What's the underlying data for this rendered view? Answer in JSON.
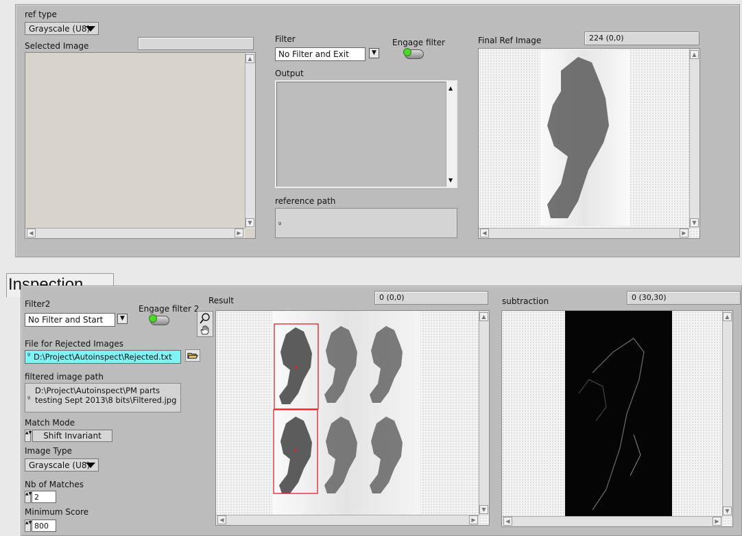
{
  "ref": {
    "ref_type_label": "ref type",
    "ref_type_value": "Grayscale (U8)",
    "selected_image_label": "Selected Image",
    "filter_label": "Filter",
    "filter_value": "No Filter and Exit",
    "engage_filter_label": "Engage filter",
    "output_label": "Output",
    "reference_path_label": "reference path",
    "final_ref_label": "Final Ref Image",
    "final_ref_readout": "224    (0,0)"
  },
  "inspection": {
    "tab_label": "Inspection",
    "filter2_label": "Filter2",
    "filter2_value": "No Filter and Start",
    "engage_filter2_label": "Engage filter 2",
    "rejected_file_label": "File for Rejected Images",
    "rejected_file_value": "D:\\Project\\Autoinspect\\Rejected.txt",
    "filtered_path_label": "filtered image path",
    "filtered_path_value": "D:\\Project\\Autoinspect\\PM parts testing Sept 2013\\8 bits\\Filtered.jpg",
    "match_mode_label": "Match Mode",
    "match_mode_value": "Shift Invariant",
    "image_type_label": "Image Type",
    "image_type_value": "Grayscale (U8)",
    "nb_matches_label": "Nb of Matches",
    "nb_matches_value": "2",
    "min_score_label": "Minimum Score",
    "min_score_value": "800",
    "result_label": "Result",
    "result_readout": "0    (0,0)",
    "subtraction_label": "subtraction",
    "subtraction_readout": "0    (30,30)"
  },
  "colors": {
    "panel_bg": "#bcbcbc",
    "path_highlight": "#7ff3f6",
    "match_box": "#e02020",
    "led_on": "#4fd62a"
  },
  "icons": [
    "dropdown-arrow-icon",
    "toggle-switch-icon",
    "folder-open-icon",
    "zoom-icon",
    "pan-hand-icon",
    "path-icon",
    "scroll-arrow-icon"
  ]
}
